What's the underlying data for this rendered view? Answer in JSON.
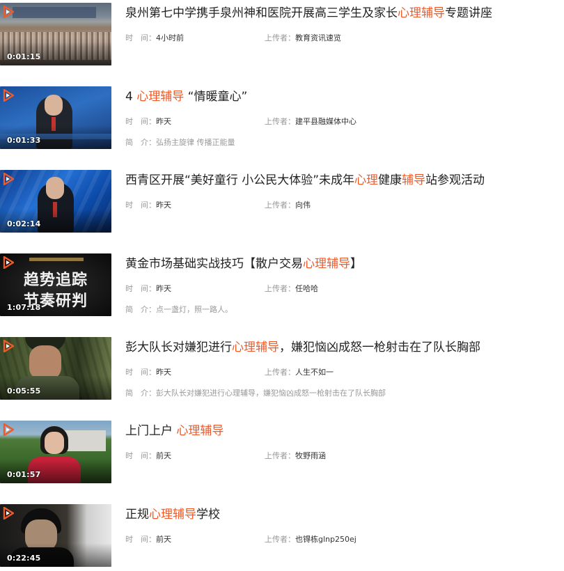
{
  "labels": {
    "time": "时　间：",
    "uploader": "上传者：",
    "intro": "简　介："
  },
  "items": [
    {
      "title_parts": [
        "泉州第七中学携手泉州神和医院开展高三学生及家长",
        "心理辅导",
        "专题讲座"
      ],
      "time": "4小时前",
      "uploader": "教育资讯速览",
      "intro": "",
      "duration": "0:01:15"
    },
    {
      "title_parts": [
        "4 ",
        "心理辅导",
        " “情暖童心”"
      ],
      "time": "昨天",
      "uploader": "建平县融媒体中心",
      "intro": "弘扬主旋律 传播正能量",
      "duration": "0:01:33"
    },
    {
      "title_parts": [
        "西青区开展“美好童行 小公民大体验”未成年",
        "心理",
        "健康",
        "辅导",
        "站参观活动"
      ],
      "time": "昨天",
      "uploader": "向伟",
      "intro": "",
      "duration": "0:02:14"
    },
    {
      "title_parts": [
        "黄金市场基础实战技巧【散户交易",
        "心理辅导",
        "】"
      ],
      "time": "昨天",
      "uploader": "任哈哈",
      "intro": "点一盏灯，照一路人。",
      "duration": "1:07:18",
      "thumb_text": [
        "趋势追踪",
        "节奏研判"
      ]
    },
    {
      "title_parts": [
        "彭大队长对嫌犯进行",
        "心理辅导",
        "，嫌犯恼凶成怒一枪射击在了队长胸部"
      ],
      "time": "昨天",
      "uploader": "人生不如一",
      "intro": "彭大队长对嫌犯进行心理辅导，嫌犯恼凶成怒一枪射击在了队长胸部",
      "duration": "0:05:55"
    },
    {
      "title_parts": [
        "上门上户 ",
        "心理辅导"
      ],
      "time": "前天",
      "uploader": "牧野雨涵",
      "intro": "",
      "duration": "0:01:57"
    },
    {
      "title_parts": [
        "正规",
        "心理辅导",
        "学校"
      ],
      "time": "前天",
      "uploader": "也锝栋glnp250ej",
      "intro": "",
      "duration": "0:22:45"
    }
  ],
  "colors": {
    "highlight": "#f05a28",
    "play_icon": "#f05a28"
  }
}
